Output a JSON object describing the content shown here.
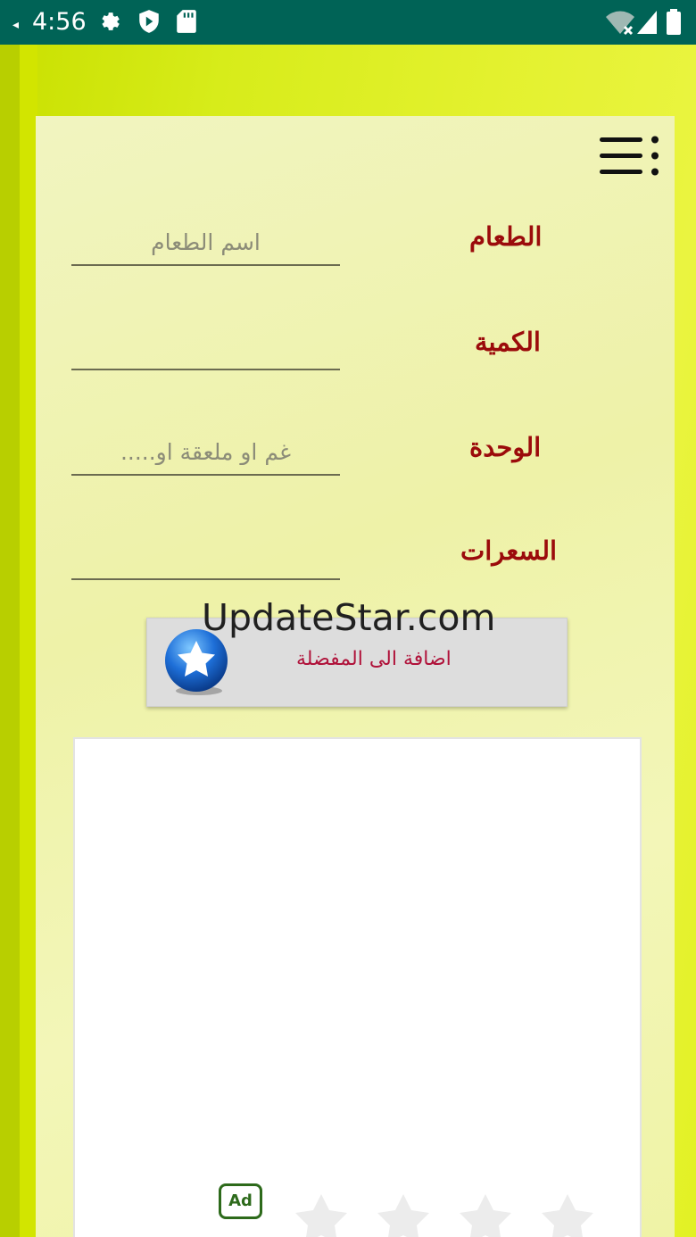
{
  "status_bar": {
    "time": "4:56",
    "icons": [
      "settings-icon",
      "shield-icon",
      "sd-card-icon",
      "wifi-icon",
      "signal-icon",
      "battery-icon"
    ],
    "background": "#006356"
  },
  "form": {
    "food_label": "الطعام",
    "food_placeholder": "اسم الطعام",
    "quantity_label": "الكمية",
    "quantity_placeholder": "",
    "unit_label": "الوحدة",
    "unit_placeholder": "غم او ملعقة او.....",
    "calories_label": "السعرات",
    "calories_placeholder": ""
  },
  "favorite_button": {
    "label": "اضافة الى المفضلة"
  },
  "watermark": "UpdateStar.com",
  "ad": {
    "badge": "Ad"
  },
  "colors": {
    "label": "#9b0b0b",
    "accent_button_text": "#b0123a",
    "background_green": "#d7ec1a"
  }
}
